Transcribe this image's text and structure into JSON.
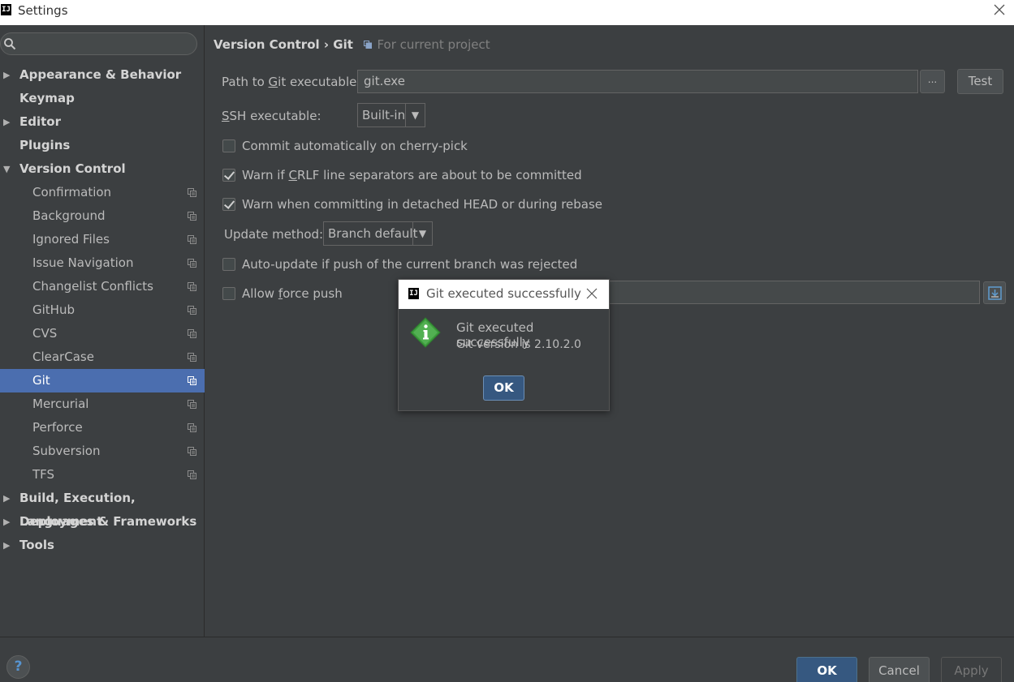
{
  "window": {
    "title": "Settings",
    "app_icon": "IJ"
  },
  "sidebar": {
    "search_value": "",
    "items": [
      {
        "label": "Appearance & Behavior",
        "expandable": true,
        "expanded": false
      },
      {
        "label": "Keymap",
        "expandable": false
      },
      {
        "label": "Editor",
        "expandable": true,
        "expanded": false
      },
      {
        "label": "Plugins",
        "expandable": false
      },
      {
        "label": "Version Control",
        "expandable": true,
        "expanded": true
      },
      {
        "label": "Confirmation",
        "child": true
      },
      {
        "label": "Background",
        "child": true
      },
      {
        "label": "Ignored Files",
        "child": true
      },
      {
        "label": "Issue Navigation",
        "child": true
      },
      {
        "label": "Changelist Conflicts",
        "child": true
      },
      {
        "label": "GitHub",
        "child": true
      },
      {
        "label": "CVS",
        "child": true
      },
      {
        "label": "ClearCase",
        "child": true
      },
      {
        "label": "Git",
        "child": true,
        "selected": true
      },
      {
        "label": "Mercurial",
        "child": true
      },
      {
        "label": "Perforce",
        "child": true
      },
      {
        "label": "Subversion",
        "child": true
      },
      {
        "label": "TFS",
        "child": true
      },
      {
        "label": "Build, Execution, Deployment",
        "expandable": true,
        "expanded": false
      },
      {
        "label": "Languages & Frameworks",
        "expandable": true,
        "expanded": false
      },
      {
        "label": "Tools",
        "expandable": true,
        "expanded": false
      }
    ]
  },
  "breadcrumb": {
    "path": "Version Control › Git",
    "scope": "For current project"
  },
  "git": {
    "path_label_pre": "Path to ",
    "path_label_u": "G",
    "path_label_post": "it executable:",
    "path_value": "git.exe",
    "browse_label": "...",
    "test_label": "Test",
    "ssh_label_u": "S",
    "ssh_label_post": "SH executable:",
    "ssh_value": "Built-in",
    "commit_cherry_label": "Commit automatically on cherry-pick",
    "commit_cherry_checked": false,
    "crlf_label_pre": "Warn if ",
    "crlf_label_u": "C",
    "crlf_label_post": "RLF line separators are about to be committed",
    "crlf_checked": true,
    "detached_label": "Warn when committing in detached HEAD or during rebase",
    "detached_checked": true,
    "update_method_label": "Update method:",
    "update_method_value": "Branch default",
    "autoupdate_label": "Auto-update if push of the current branch was rejected",
    "autoupdate_checked": false,
    "force_push_label_pre": "Allow ",
    "force_push_label_u": "f",
    "force_push_label_post": "orce push",
    "force_push_checked": false
  },
  "popup": {
    "title": "Git executed successfully",
    "message": "Git executed successfully",
    "version": "Git version is 2.10.2.0",
    "ok_label": "OK"
  },
  "footer": {
    "help_label": "?",
    "ok_label": "OK",
    "cancel_label": "Cancel",
    "apply_label": "Apply"
  },
  "colors": {
    "selection": "#4b6eaf",
    "primary_button": "#365880",
    "background": "#3c3f41"
  }
}
